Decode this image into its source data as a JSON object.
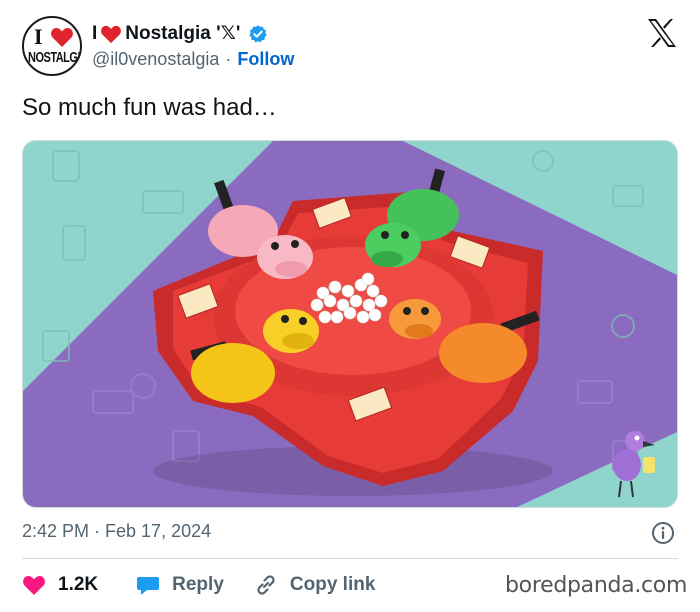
{
  "author": {
    "display_name": "I❤Nostalgia '𝕏'",
    "name_prefix": "I",
    "name_suffix": "Nostalgia '𝕏'",
    "handle": "@il0venostalgia",
    "separator": "·",
    "follow_label": "Follow",
    "avatar_text_top": "I",
    "avatar_text_bottom": "NOSTALGIA",
    "verified_icon": "verified-badge-icon",
    "verified_color": "#1d9bf0"
  },
  "tweet": {
    "text": "So much fun was had…",
    "timestamp": "2:42 PM · Feb 17, 2024",
    "image_description_icon": "hungry-hippos-board-game-photo"
  },
  "actions": {
    "like_count": "1.2K",
    "reply_label": "Reply",
    "copy_link_label": "Copy link"
  },
  "watermark": "boredpanda.com",
  "colors": {
    "like": "#f91880",
    "reply": "#1d9bf0",
    "follow": "#0066cc",
    "muted": "#536471"
  }
}
